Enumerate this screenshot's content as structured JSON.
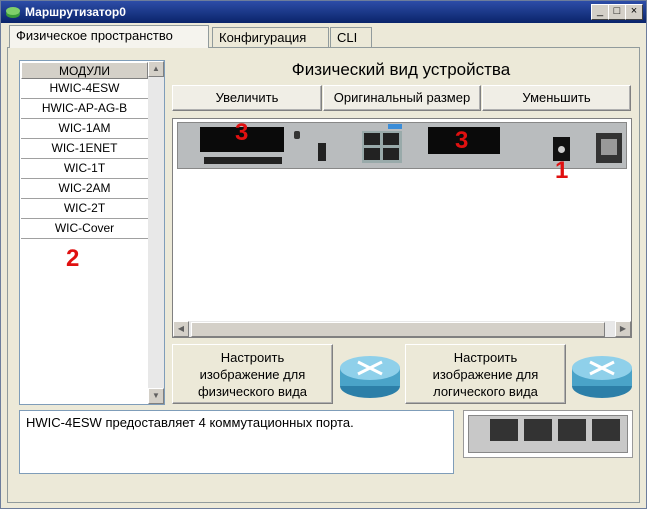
{
  "window": {
    "title": "Маршрутизатор0"
  },
  "tabs": [
    {
      "label": "Физическое пространство"
    },
    {
      "label": "Конфигурация"
    },
    {
      "label": "CLI"
    }
  ],
  "modules": {
    "header": "МОДУЛИ",
    "items": [
      "HWIC-4ESW",
      "HWIC-AP-AG-B",
      "WIC-1AM",
      "WIC-1ENET",
      "WIC-1T",
      "WIC-2AM",
      "WIC-2T",
      "WIC-Cover"
    ]
  },
  "physical": {
    "heading": "Физический вид устройства",
    "zoom_in": "Увеличить",
    "original_size": "Оригинальный размер",
    "zoom_out": "Уменьшить"
  },
  "customize": {
    "physical_line1": "Настроить",
    "physical_line2": "изображение для",
    "physical_line3": "физического вида",
    "logical_line1": "Настроить",
    "logical_line2": "изображение для",
    "logical_line3": "логического вида"
  },
  "description": "HWIC-4ESW предоставляет 4 коммутационных порта.",
  "annotations": {
    "slot_marker": "3",
    "switch_marker": "1",
    "list_marker": "2"
  },
  "colors": {
    "annotation": "#e01010",
    "titlebar": "#0a246a"
  }
}
